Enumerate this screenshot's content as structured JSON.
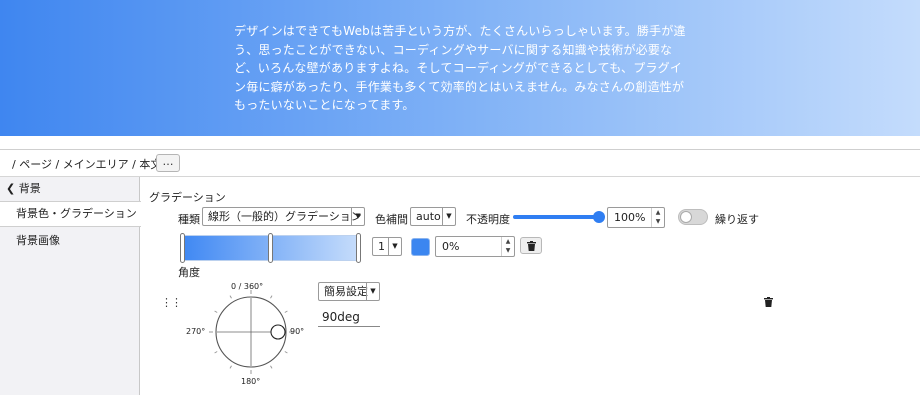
{
  "hero": {
    "text": "デザインはできてもWebは苦手という方が、たくさんいらっしゃいます。勝手が違う、思ったことができない、コーディングやサーバに関する知識や技術が必要など、いろんな壁がありますよね。そしてコーディングができるとしても、プラグイン毎に癖があったり、手作業も多くて効率的とはいえません。みなさんの創造性がもったいないことになってます。",
    "colors": {
      "start": "#3f86f0",
      "end": "#c4dcfc"
    }
  },
  "breadcrumb": {
    "text": "/ ページ / メインエリア / 本文",
    "more_label": "…"
  },
  "sidebar": {
    "group_label": "背景",
    "items": [
      {
        "label": "背景色・グラデーション",
        "active": true
      },
      {
        "label": "背景画像",
        "active": false
      }
    ]
  },
  "gradient": {
    "section_title": "グラデーション",
    "type_label": "種類",
    "type_value": "線形（一般的）グラデーション",
    "interp_label": "色補間",
    "interp_value": "auto",
    "opacity_label": "不透明度",
    "opacity_value": "100%",
    "opacity_level": 1.0,
    "repeat_label": "繰り返す",
    "repeat_on": false,
    "stop_index": "1",
    "stop_color": "#3b86f0",
    "stop_position": "0%",
    "angle_label": "角度",
    "dial": {
      "top": "0 / 360°",
      "right": "90°",
      "bottom": "180°",
      "left": "270°"
    },
    "angle_mode": "簡易設定",
    "angle_value": "90deg"
  }
}
